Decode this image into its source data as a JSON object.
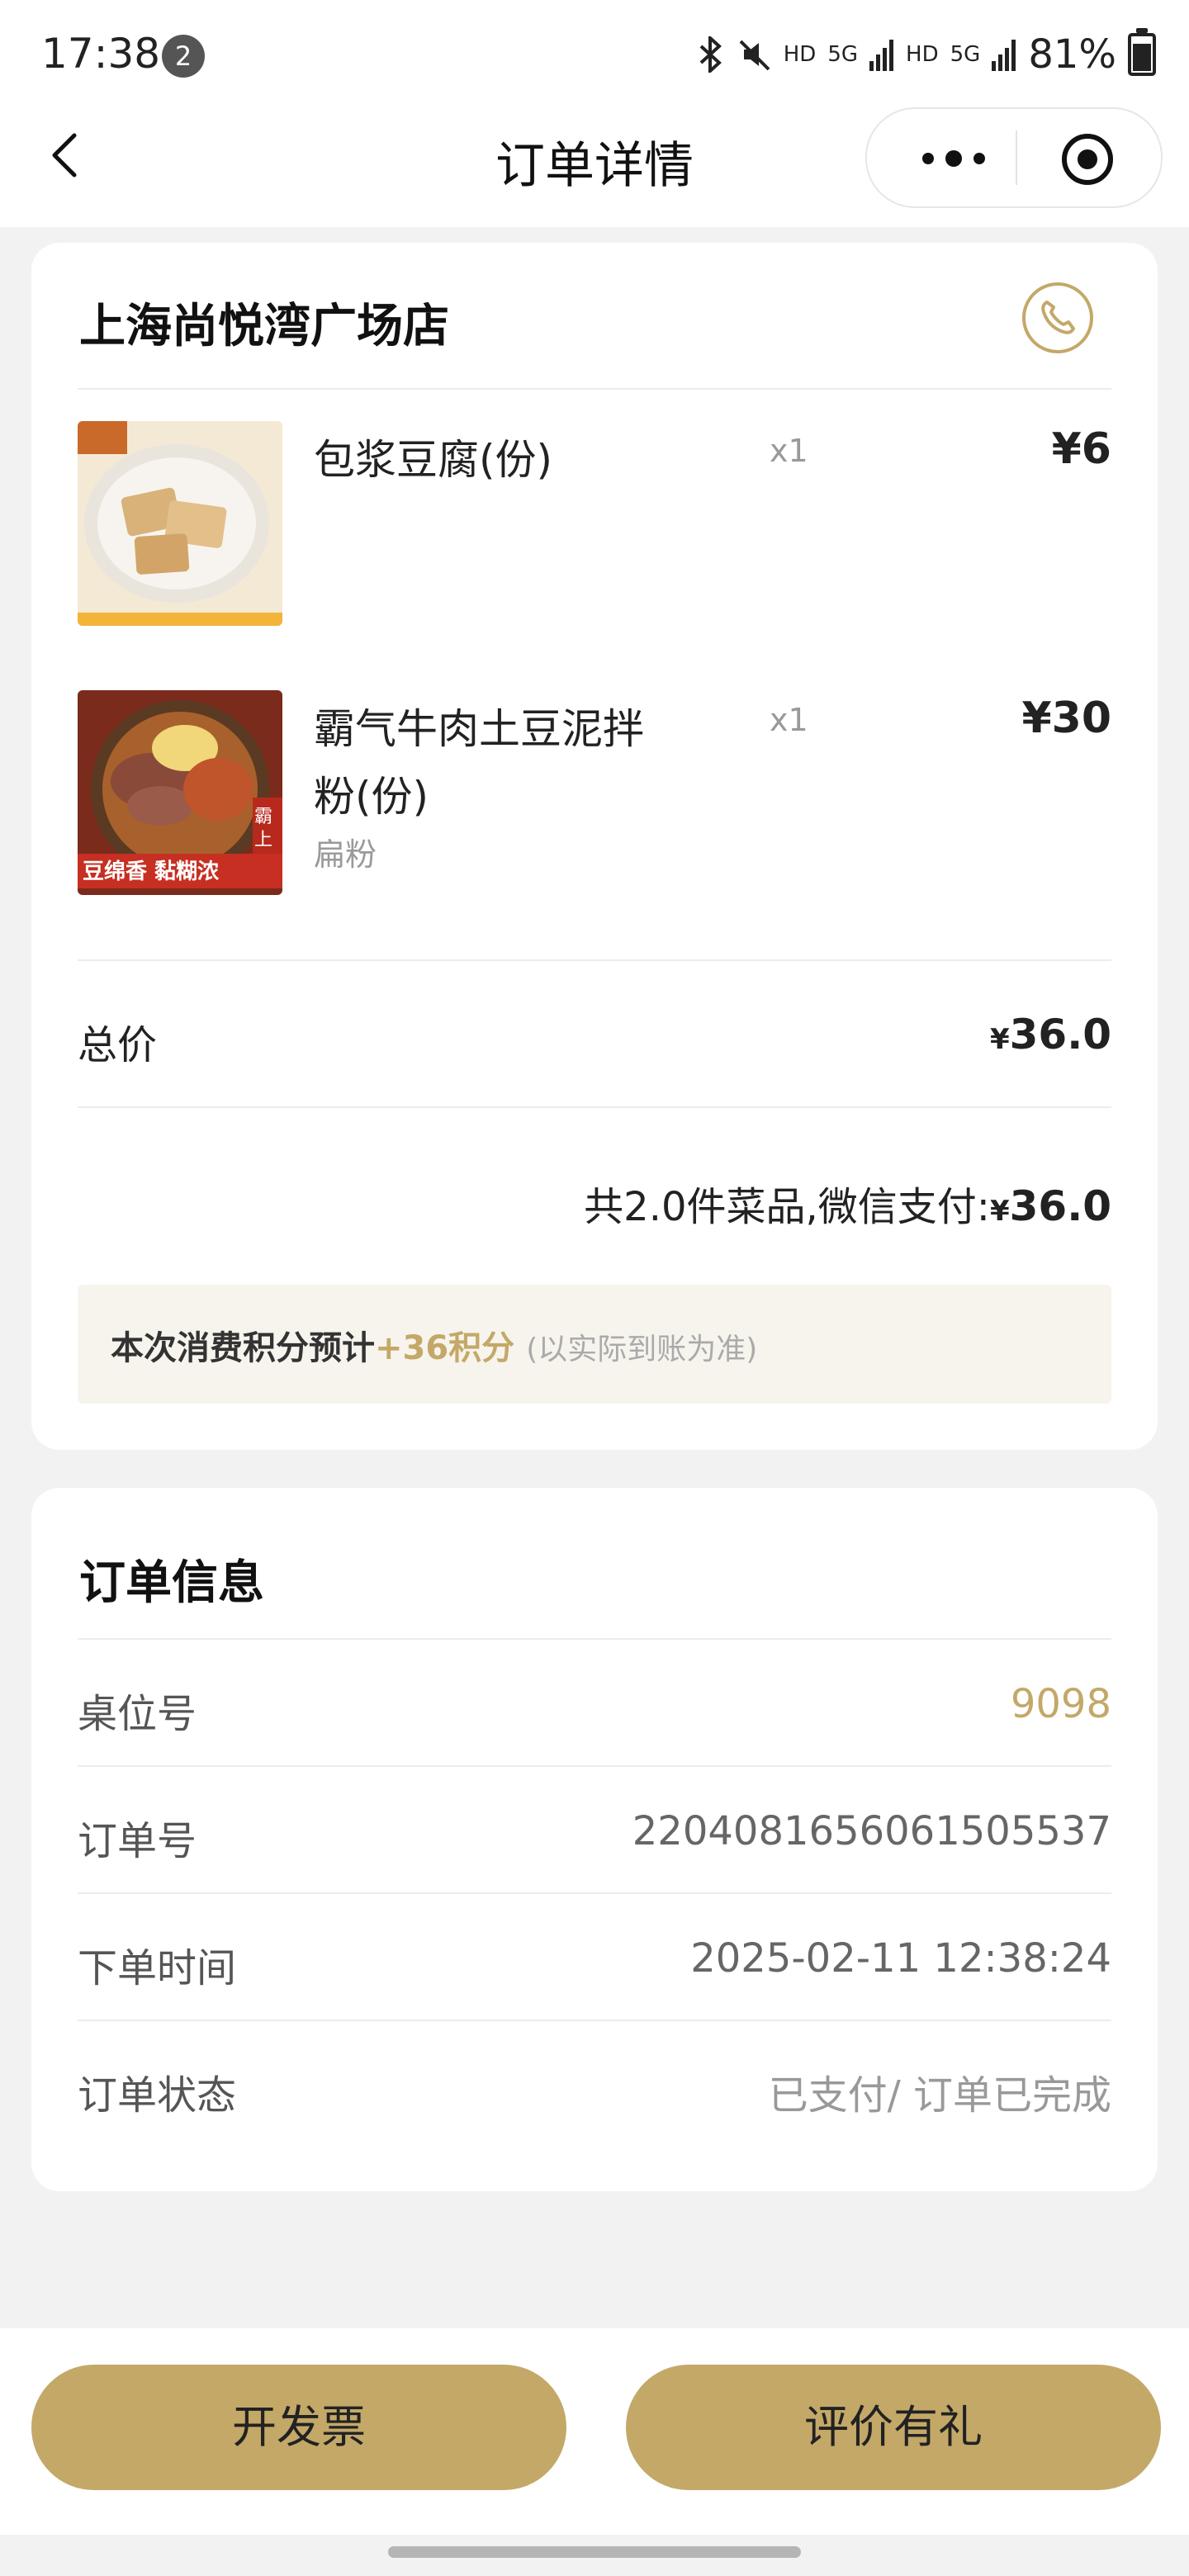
{
  "status_bar": {
    "time": "17:38",
    "notification_count": "2",
    "network_labels": [
      "HD",
      "5G",
      "HD",
      "5G"
    ],
    "battery": "81%"
  },
  "nav": {
    "title": "订单详情"
  },
  "store": {
    "name": "上海尚悦湾广场店"
  },
  "items": [
    {
      "name": "包浆豆腐(份)",
      "spec": "",
      "qty": "x1",
      "price": "¥6"
    },
    {
      "name": "霸气牛肉土豆泥拌粉(份)",
      "spec": "扁粉",
      "qty": "x1",
      "price": "¥30",
      "image_text_top": "霸\n上",
      "image_text_banner": "豆绵香 黏糊浓"
    }
  ],
  "totals": {
    "total_label": "总价",
    "currency": "¥",
    "total_value": "36.0",
    "summary_prefix": "共2.0件菜品,微信支付:",
    "summary_value": "36.0"
  },
  "points": {
    "label": "本次消费积分预计",
    "points": "+36积分",
    "note": "(以实际到账为准)"
  },
  "order_info": {
    "title": "订单信息",
    "rows": [
      {
        "label": "桌位号",
        "value": "9098"
      },
      {
        "label": "订单号",
        "value": "2204081656061505537"
      },
      {
        "label": "下单时间",
        "value": "2025-02-11 12:38:24"
      },
      {
        "label": "订单状态",
        "value": "已支付/ 订单已完成"
      }
    ]
  },
  "actions": {
    "invoice": "开发票",
    "review": "评价有礼"
  },
  "colors": {
    "accent": "#c3a868",
    "background": "#f2f2f2"
  }
}
